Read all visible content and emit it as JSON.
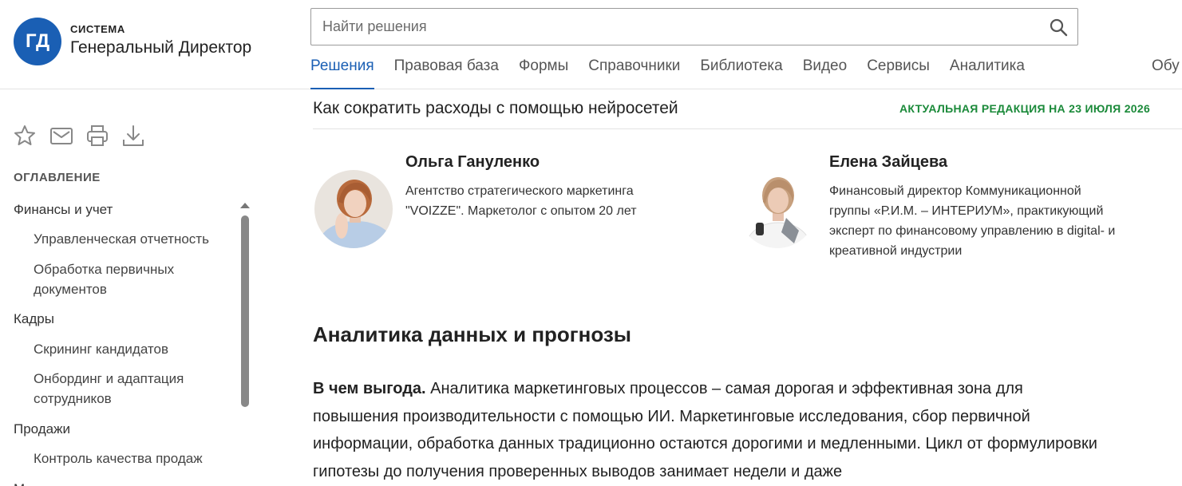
{
  "logo": {
    "initials": "ГД",
    "small": "СИСТЕМА",
    "big": "Генеральный Директор"
  },
  "search": {
    "placeholder": "Найти решения"
  },
  "nav": {
    "items": [
      "Решения",
      "Правовая база",
      "Формы",
      "Справочники",
      "Библиотека",
      "Видео",
      "Сервисы",
      "Аналитика"
    ],
    "more": "Обу"
  },
  "toolbar": {
    "icons": [
      "star-icon",
      "mail-icon",
      "print-icon",
      "download-icon"
    ]
  },
  "toc": {
    "title": "ОГЛАВЛЕНИЕ",
    "items": [
      {
        "label": "Финансы и учет",
        "level": 1
      },
      {
        "label": "Управленческая отчетность",
        "level": 2
      },
      {
        "label": "Обработка первичных документов",
        "level": 2
      },
      {
        "label": "Кадры",
        "level": 1
      },
      {
        "label": "Скрининг кандидатов",
        "level": 2
      },
      {
        "label": "Онбординг и адаптация сотрудников",
        "level": 2
      },
      {
        "label": "Продажи",
        "level": 1
      },
      {
        "label": "Контроль качества продаж",
        "level": 2
      },
      {
        "label": "М…",
        "level": 1
      }
    ]
  },
  "document": {
    "title": "Как сократить расходы с помощью нейросетей",
    "edition": "АКТУАЛЬНАЯ РЕДАКЦИЯ НА 23 ИЮЛЯ 2026",
    "authors": [
      {
        "name": "Ольга Гануленко",
        "description": "Агентство стратегического маркетинга \"VOIZZE\". Маркетолог с опытом 20 лет"
      },
      {
        "name": "Елена Зайцева",
        "description": "Финансовый директор Коммуникационной группы «Р.И.М. – ИНТЕРИУМ», практикующий эксперт по финансовому управлению в digital- и креативной индустрии"
      }
    ],
    "section_title": "Аналитика данных и прогнозы",
    "paragraph_lead": "В чем выгода.",
    "paragraph_text": " Аналитика маркетинговых процессов – самая дорогая и эффективная зона для повышения производительности с помощью ИИ. Маркетинговые исследования, сбор первичной информации, обработка данных традиционно остаются дорогими и медленными. Цикл от формулировки гипотезы до получения проверенных выводов занимает недели и даже"
  },
  "colors": {
    "brand": "#1a5fb4",
    "edition": "#1b8a3a"
  }
}
